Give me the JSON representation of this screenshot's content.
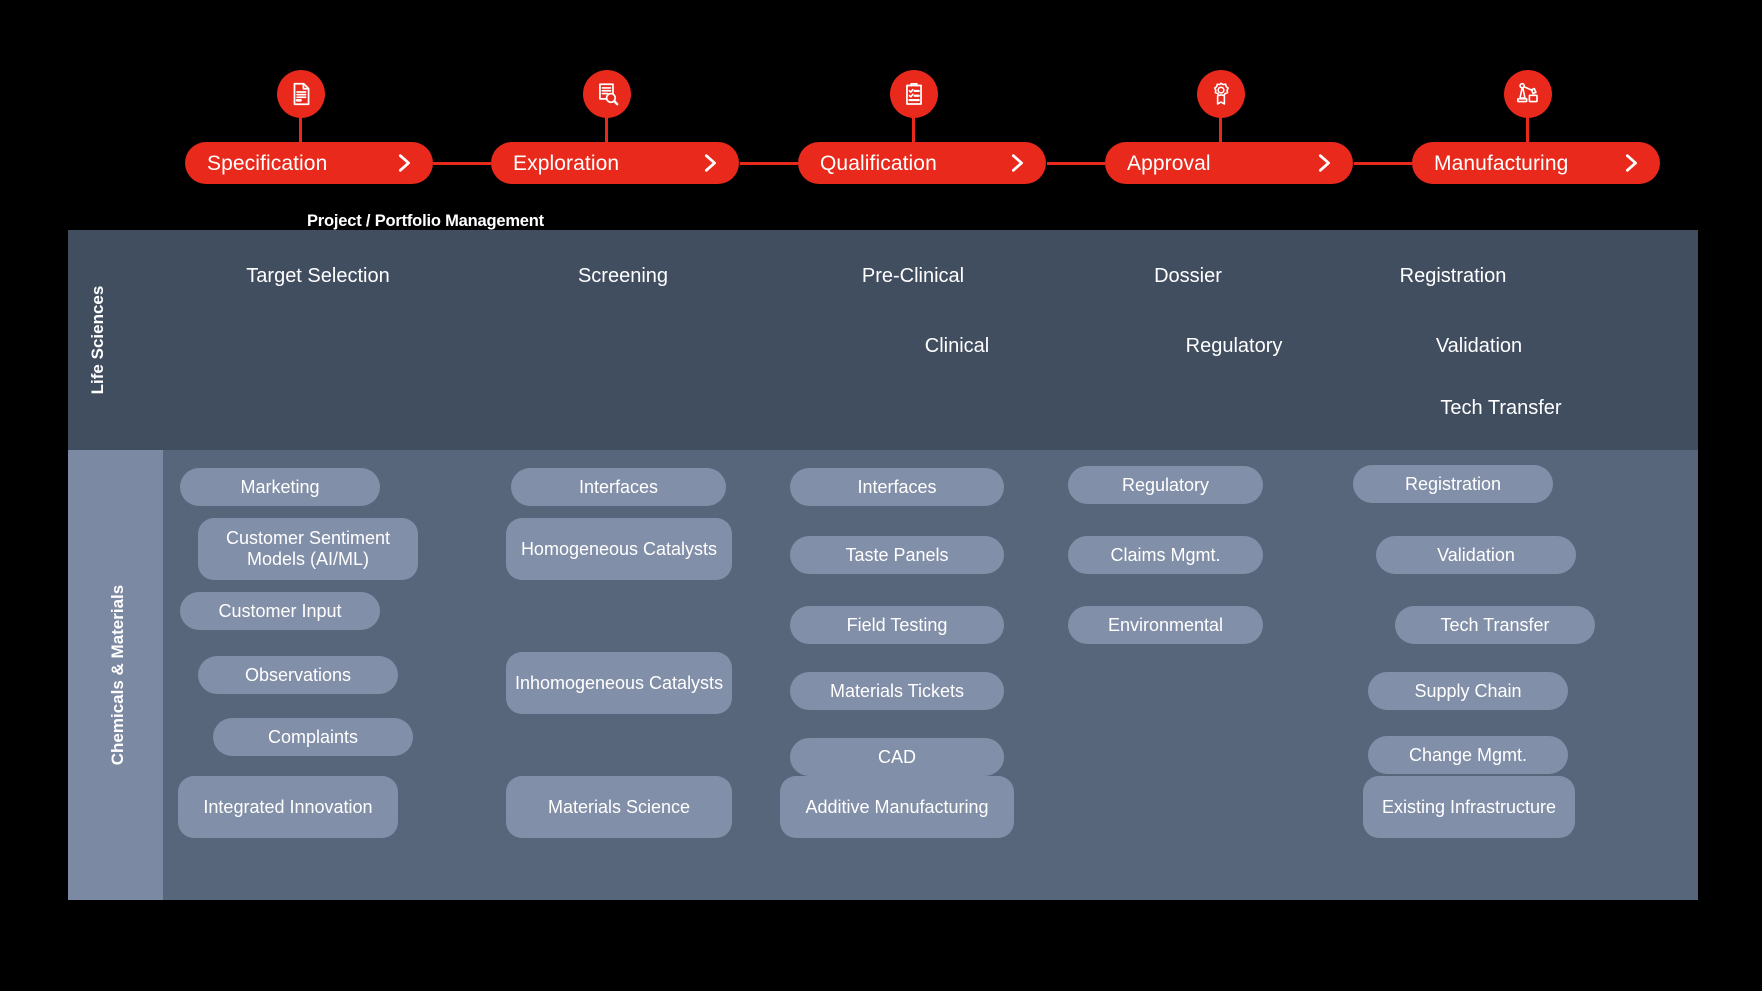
{
  "process": {
    "stages": [
      {
        "label": "Specification",
        "icon": "document-icon",
        "chevron": "chevron-right-icon"
      },
      {
        "label": "Exploration",
        "icon": "document-search-icon",
        "chevron": "chevron-right-icon"
      },
      {
        "label": "Qualification",
        "icon": "clipboard-check-icon",
        "chevron": "chevron-right-icon"
      },
      {
        "label": "Approval",
        "icon": "award-seal-icon",
        "chevron": "chevron-right-icon"
      },
      {
        "label": "Manufacturing",
        "icon": "robot-arm-icon",
        "chevron": "chevron-right-icon"
      }
    ],
    "accent_color": "#E8291C"
  },
  "ppm": {
    "label": "Project / Portfolio Management"
  },
  "panel": {
    "life_sciences": {
      "vertical_label": "Life Sciences",
      "band_color": "#414E60",
      "columns": [
        {
          "items": [
            "Target Selection"
          ]
        },
        {
          "items": [
            "Screening"
          ]
        },
        {
          "items": [
            "Pre-Clinical",
            "Clinical"
          ]
        },
        {
          "items": [
            "Dossier",
            "Regulatory"
          ]
        },
        {
          "items": [
            "Registration",
            "Validation",
            "Tech Transfer"
          ]
        }
      ]
    },
    "chemicals_materials": {
      "vertical_label": "Chemicals & Materials",
      "band_color": "#58667B",
      "sidebar_color": "#7C89A2",
      "pill_color": "#828FA8",
      "columns": [
        {
          "items": [
            "Marketing",
            "Customer Sentiment Models (AI/ML)",
            "Customer Input",
            "Observations",
            "Complaints",
            "Integrated Innovation"
          ]
        },
        {
          "items": [
            "Interfaces",
            "Homogeneous Catalysts",
            "Inhomogeneous Catalysts",
            "Materials Science"
          ]
        },
        {
          "items": [
            "Interfaces",
            "Taste Panels",
            "Field Testing",
            "Materials Tickets",
            "CAD",
            "Additive Manufacturing"
          ]
        },
        {
          "items": [
            "Regulatory",
            "Claims Mgmt.",
            "Environmental"
          ]
        },
        {
          "items": [
            "Registration",
            "Validation",
            "Tech Transfer",
            "Supply Chain",
            "Change Mgmt.",
            "Existing Infrastructure"
          ]
        }
      ]
    }
  }
}
